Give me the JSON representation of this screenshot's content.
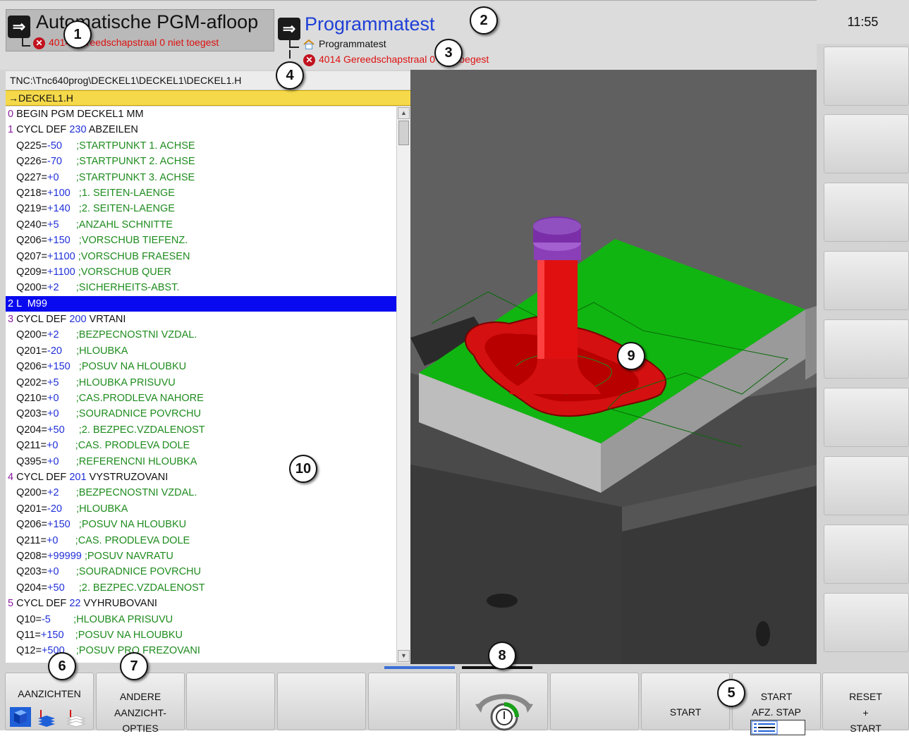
{
  "header": {
    "mode1": {
      "title": "Automatische PGM-afloop",
      "error": "4014 Gereedschapstraal 0 niet toegest"
    },
    "mode2": {
      "title": "Programmatest",
      "sub": "Programmatest",
      "error": "4014 Gereedschapstraal 0 niet toegest"
    },
    "clock": "11:55"
  },
  "program": {
    "path": "TNC:\\Tnc640prog\\DECKEL1\\DECKEL1\\DECKEL1.H",
    "name": "→DECKEL1.H",
    "lines": [
      {
        "n": "0",
        "t": " BEGIN PGM DECKEL1 MM"
      },
      {
        "n": "1",
        "t": " CYCL DEF ",
        "b": "230",
        "t2": " ABZEILEN"
      },
      {
        "p": "   Q225=",
        "b": "-50",
        "c": "     ;STARTPUNKT 1. ACHSE"
      },
      {
        "p": "   Q226=",
        "b": "-70",
        "c": "     ;STARTPUNKT 2. ACHSE"
      },
      {
        "p": "   Q227=",
        "b": "+0",
        "c": "      ;STARTPUNKT 3. ACHSE"
      },
      {
        "p": "   Q218=",
        "b": "+100",
        "c": "   ;1. SEITEN-LAENGE"
      },
      {
        "p": "   Q219=",
        "b": "+140",
        "c": "   ;2. SEITEN-LAENGE"
      },
      {
        "p": "   Q240=",
        "b": "+5",
        "c": "      ;ANZAHL SCHNITTE"
      },
      {
        "p": "   Q206=",
        "b": "+150",
        "c": "   ;VORSCHUB TIEFENZ."
      },
      {
        "p": "   Q207=",
        "b": "+1100",
        "c": " ;VORSCHUB FRAESEN"
      },
      {
        "p": "   Q209=",
        "b": "+1100",
        "c": " ;VORSCHUB QUER"
      },
      {
        "p": "   Q200=",
        "b": "+2",
        "c": "      ;SICHERHEITS-ABST."
      },
      {
        "n": "2",
        "t": " L  M99",
        "sel": true
      },
      {
        "n": "3",
        "t": " CYCL DEF ",
        "b": "200",
        "t2": " VRTANI"
      },
      {
        "p": "   Q200=",
        "b": "+2",
        "c": "      ;BEZPECNOSTNI VZDAL."
      },
      {
        "p": "   Q201=",
        "b": "-20",
        "c": "     ;HLOUBKA"
      },
      {
        "p": "   Q206=",
        "b": "+150",
        "c": "   ;POSUV NA HLOUBKU"
      },
      {
        "p": "   Q202=",
        "b": "+5",
        "c": "      ;HLOUBKA PRISUVU"
      },
      {
        "p": "   Q210=",
        "b": "+0",
        "c": "      ;CAS.PRODLEVA NAHORE"
      },
      {
        "p": "   Q203=",
        "b": "+0",
        "c": "      ;SOURADNICE POVRCHU"
      },
      {
        "p": "   Q204=",
        "b": "+50",
        "c": "     ;2. BEZPEC.VZDALENOST"
      },
      {
        "p": "   Q211=",
        "b": "+0",
        "c": "      ;CAS. PRODLEVA DOLE"
      },
      {
        "p": "   Q395=",
        "b": "+0",
        "c": "      ;REFERENCNI HLOUBKA"
      },
      {
        "n": "4",
        "t": " CYCL DEF ",
        "b": "201",
        "t2": " VYSTRUZOVANI"
      },
      {
        "p": "   Q200=",
        "b": "+2",
        "c": "      ;BEZPECNOSTNI VZDAL."
      },
      {
        "p": "   Q201=",
        "b": "-20",
        "c": "     ;HLOUBKA"
      },
      {
        "p": "   Q206=",
        "b": "+150",
        "c": "   ;POSUV NA HLOUBKU"
      },
      {
        "p": "   Q211=",
        "b": "+0",
        "c": "      ;CAS. PRODLEVA DOLE"
      },
      {
        "p": "   Q208=",
        "b": "+99999",
        "c": " ;POSUV NAVRATU"
      },
      {
        "p": "   Q203=",
        "b": "+0",
        "c": "      ;SOURADNICE POVRCHU"
      },
      {
        "p": "   Q204=",
        "b": "+50",
        "c": "     ;2. BEZPEC.VZDALENOST"
      },
      {
        "n": "5",
        "t": " CYCL DEF ",
        "b": "22",
        "t2": " VYHRUBOVANI"
      },
      {
        "p": "   Q10=",
        "b": "-5",
        "c": "        ;HLOUBKA PRISUVU"
      },
      {
        "p": "   Q11=",
        "b": "+150",
        "c": "    ;POSUV NA HLOUBKU"
      },
      {
        "p": "   Q12=",
        "b": "+500",
        "c": "    ;POSUV PRO FREZOVANI"
      }
    ]
  },
  "softkeys": {
    "aanzichten": "AANZICHTEN",
    "andere": [
      "ANDERE",
      "AANZICHT-",
      "OPTIES"
    ],
    "start": "START",
    "start_stap": [
      "START",
      "AFZ. STAP"
    ],
    "reset": [
      "RESET",
      "+",
      "START"
    ]
  },
  "callouts": [
    "1",
    "2",
    "3",
    "4",
    "5",
    "6",
    "7",
    "8",
    "9",
    "10"
  ],
  "colors": {
    "selection": "#0a0af0",
    "comment": "#1f8c1f",
    "value": "#1f2fd8",
    "error": "#d11",
    "title2": "#1f3fd6",
    "progbar": "#f5d94a"
  }
}
